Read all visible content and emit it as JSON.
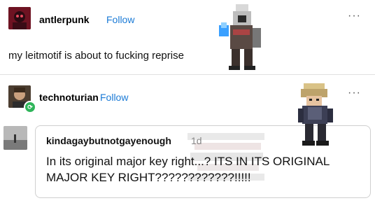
{
  "posts": [
    {
      "username": "antlerpunk",
      "follow_label": "Follow",
      "more_label": "···",
      "body": "my leitmotif is about to fucking reprise"
    },
    {
      "username": "technoturian",
      "follow_label": "Follow",
      "more_label": "···",
      "reply": {
        "username": "kindagaybutnotgayenough",
        "time": "1d",
        "text": "In its original major key right...? ITS IN ITS ORIGINAL MAJOR KEY RIGHT????????????!!!!!"
      }
    }
  ],
  "icons": {
    "post1_avatar": "avatar-icon",
    "post2_avatar": "avatar-icon",
    "reblog_badge": "reblog-icon",
    "more": "more-options-icon"
  },
  "colors": {
    "follow": "#1a7ad6",
    "reblog_badge": "#2fb55a",
    "divider": "#e1e1e1"
  }
}
